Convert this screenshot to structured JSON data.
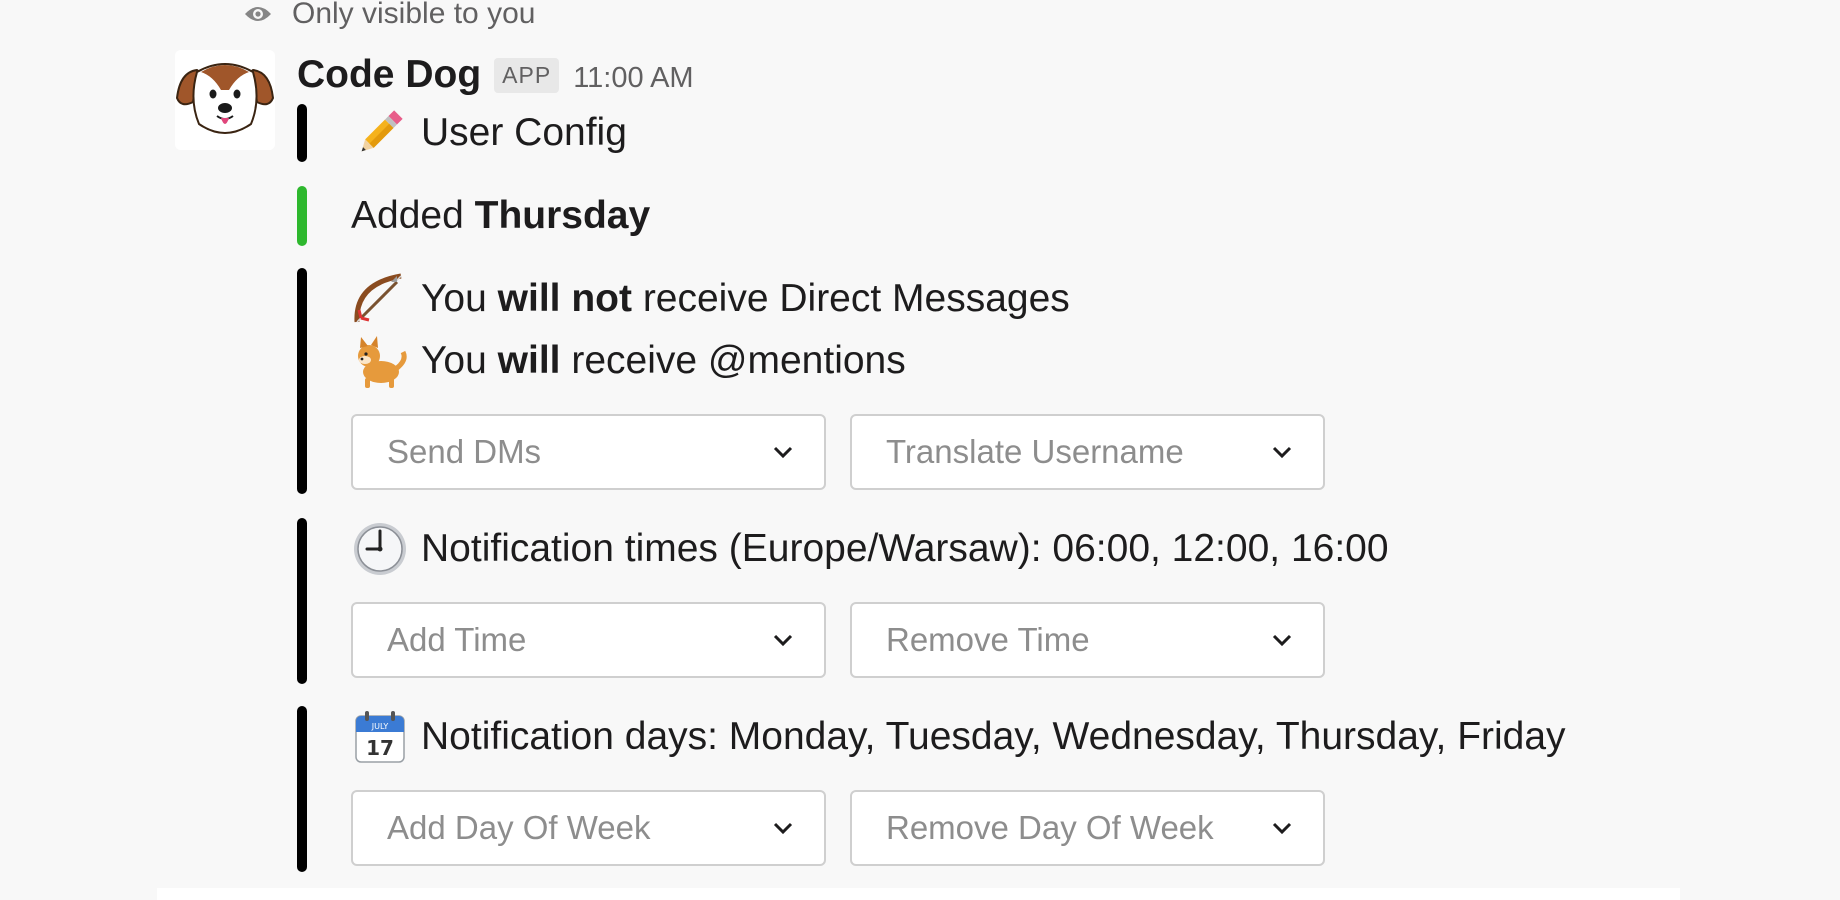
{
  "visibility_note": "Only visible to you",
  "message": {
    "sender": "Code Dog",
    "badge": "APP",
    "time": "11:00 AM"
  },
  "config_title": "User Config",
  "added": {
    "prefix": "Added",
    "day": "Thursday"
  },
  "dm_setting": {
    "pre": "You",
    "status": "will not",
    "post": "receive Direct Messages"
  },
  "mention_setting": {
    "pre": "You",
    "status": "will",
    "post": "receive @mentions"
  },
  "dm_selects": {
    "send_dms": "Send DMs",
    "translate_username": "Translate Username"
  },
  "notification_times": "Notification times (Europe/Warsaw): 06:00, 12:00, 16:00",
  "time_selects": {
    "add": "Add Time",
    "remove": "Remove Time"
  },
  "notification_days": "Notification days: Monday, Tuesday, Wednesday, Thursday, Friday",
  "day_selects": {
    "add": "Add Day Of Week",
    "remove": "Remove Day Of Week"
  },
  "calendar_icon": {
    "month": "JULY",
    "day": "17"
  },
  "colors": {
    "attachment_bar": "#000000",
    "added_bar": "#2eb82e",
    "background": "#f8f8f8"
  },
  "icons": [
    "eye-icon",
    "pencil-icon",
    "bow-arrow-icon",
    "dog-icon",
    "clock-icon",
    "calendar-icon",
    "chevron-down-icon"
  ]
}
